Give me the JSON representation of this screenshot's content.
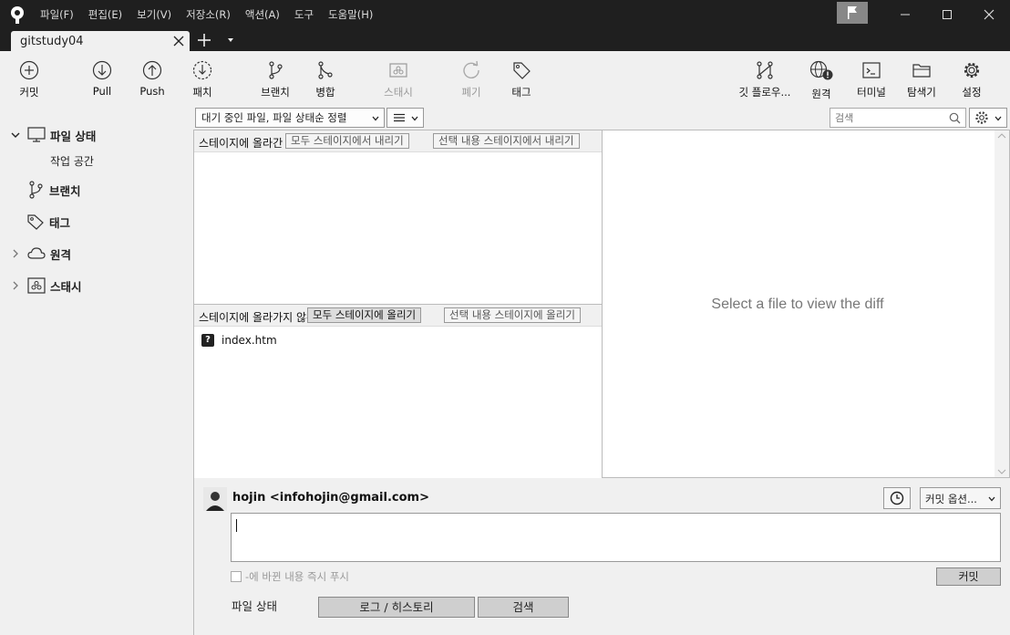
{
  "menu": [
    "파일(F)",
    "편집(E)",
    "보기(V)",
    "저장소(R)",
    "액션(A)",
    "도구",
    "도움말(H)"
  ],
  "tab": {
    "title": "gitstudy04"
  },
  "toolbar": {
    "commit": "커밋",
    "pull": "Pull",
    "push": "Push",
    "fetch": "패치",
    "branch": "브랜치",
    "merge": "병합",
    "stash": "스태시",
    "discard": "폐기",
    "tag": "태그",
    "gitflow": "깃 플로우...",
    "remote": "원격",
    "terminal": "터미널",
    "explorer": "탐색기",
    "settings": "설정"
  },
  "sidebar": {
    "file_status": "파일 상태",
    "working_copy": "작업 공간",
    "branches": "브랜치",
    "tags": "태그",
    "remotes": "원격",
    "stashes": "스태시"
  },
  "filter": {
    "sort": "대기 중인 파일, 파일 상태순 정렬",
    "search_placeholder": "검색"
  },
  "staged": {
    "title": "스테이지에 올라간 파일",
    "unstage_all": "모두 스테이지에서 내리기",
    "unstage_selected": "선택 내용 스테이지에서 내리기"
  },
  "unstaged": {
    "title": "스테이지에 올라가지 않은 파일",
    "stage_all": "모두 스테이지에 올리기",
    "stage_selected": "선택 내용 스테이지에 올리기",
    "files": [
      {
        "name": "index.htm",
        "status": "?"
      }
    ]
  },
  "diff": {
    "placeholder": "Select a file to view the diff"
  },
  "commit": {
    "author": "hojin <infohojin@gmail.com>",
    "options": "커밋 옵션...",
    "push_now": "-에 바뀐 내용 즉시 푸시",
    "button": "커밋"
  },
  "bottom_tabs": [
    "파일 상태",
    "로그 / 히스토리",
    "검색"
  ]
}
